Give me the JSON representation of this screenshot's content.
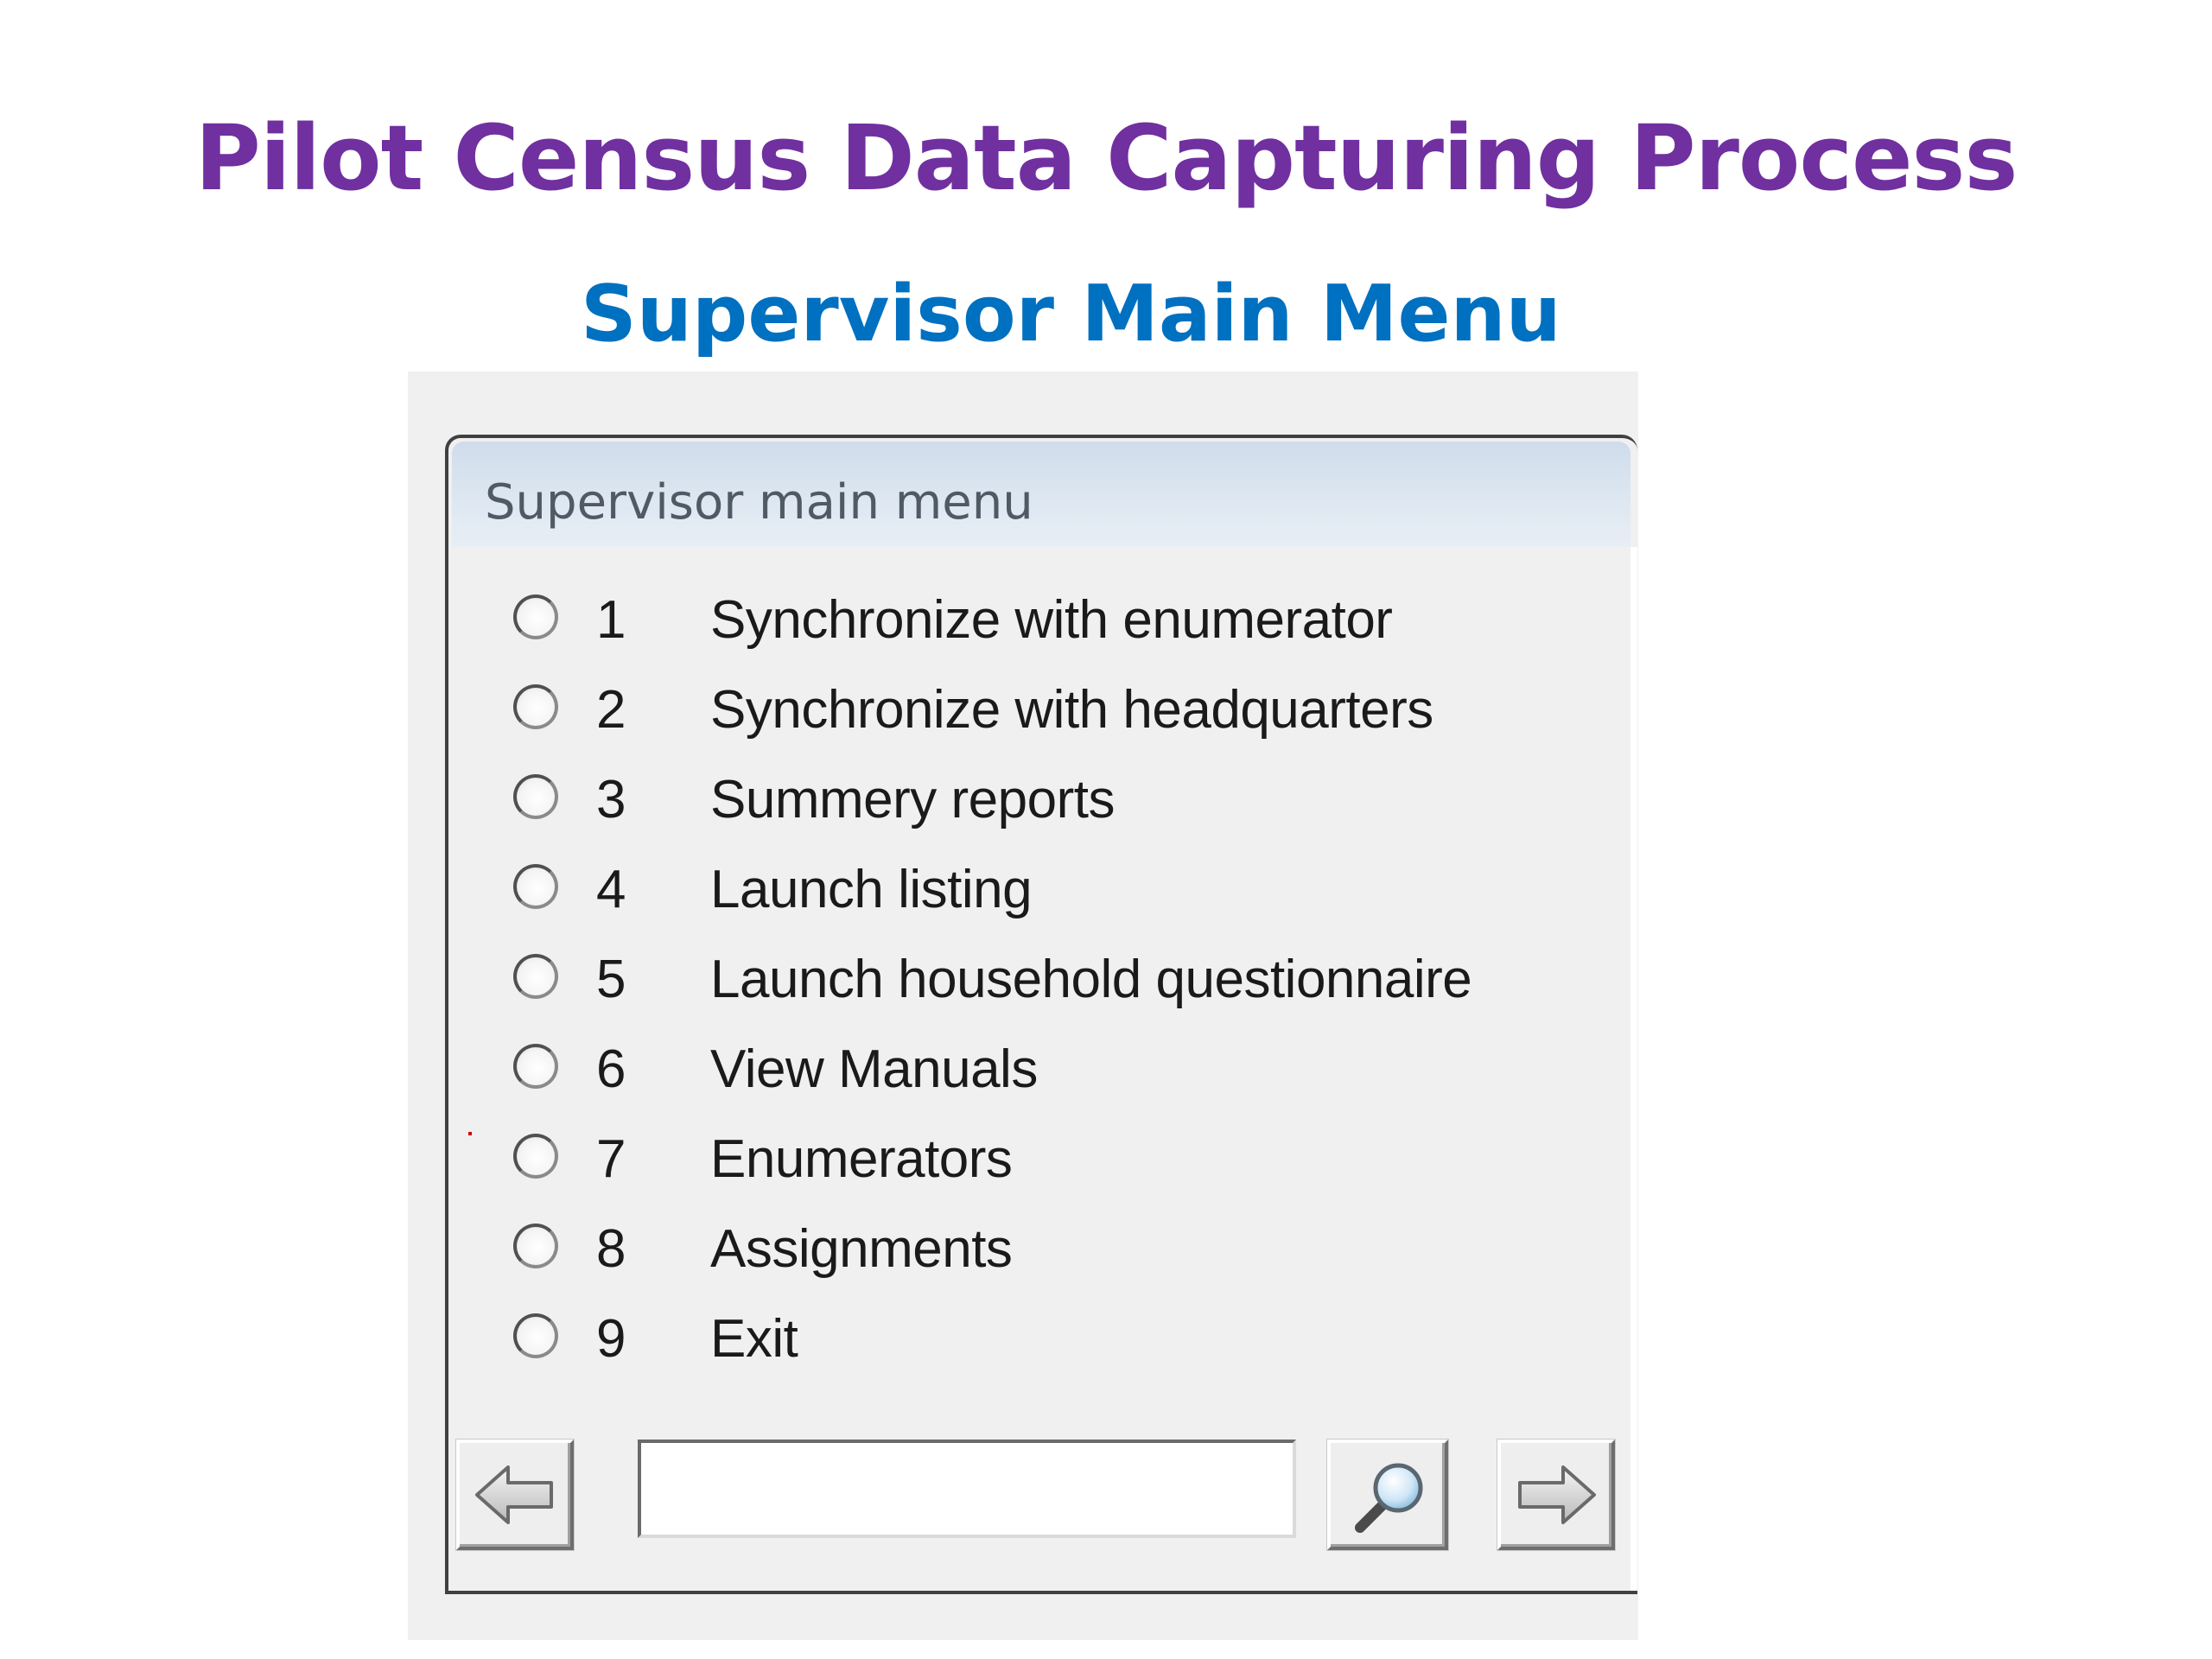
{
  "slide": {
    "title": "Pilot Census Data Capturing Process",
    "subtitle": "Supervisor Main Menu"
  },
  "window": {
    "title": "Supervisor main menu"
  },
  "menu": {
    "items": [
      {
        "number": "1",
        "label": "Synchronize with enumerator"
      },
      {
        "number": "2",
        "label": "Synchronize with headquarters"
      },
      {
        "number": "3",
        "label": "Summery reports"
      },
      {
        "number": "4",
        "label": "Launch listing"
      },
      {
        "number": "5",
        "label": "Launch household questionnaire"
      },
      {
        "number": "6",
        "label": "View Manuals"
      },
      {
        "number": "7",
        "label": "Enumerators"
      },
      {
        "number": "8",
        "label": "Assignments"
      },
      {
        "number": "9",
        "label": "Exit"
      }
    ]
  },
  "toolbar": {
    "back_icon": "left-arrow-icon",
    "search_icon": "magnifier-icon",
    "next_icon": "right-arrow-icon",
    "search_value": ""
  },
  "colors": {
    "title": "#7030a0",
    "subtitle": "#0070c0",
    "window_background": "#f0f0f0"
  }
}
